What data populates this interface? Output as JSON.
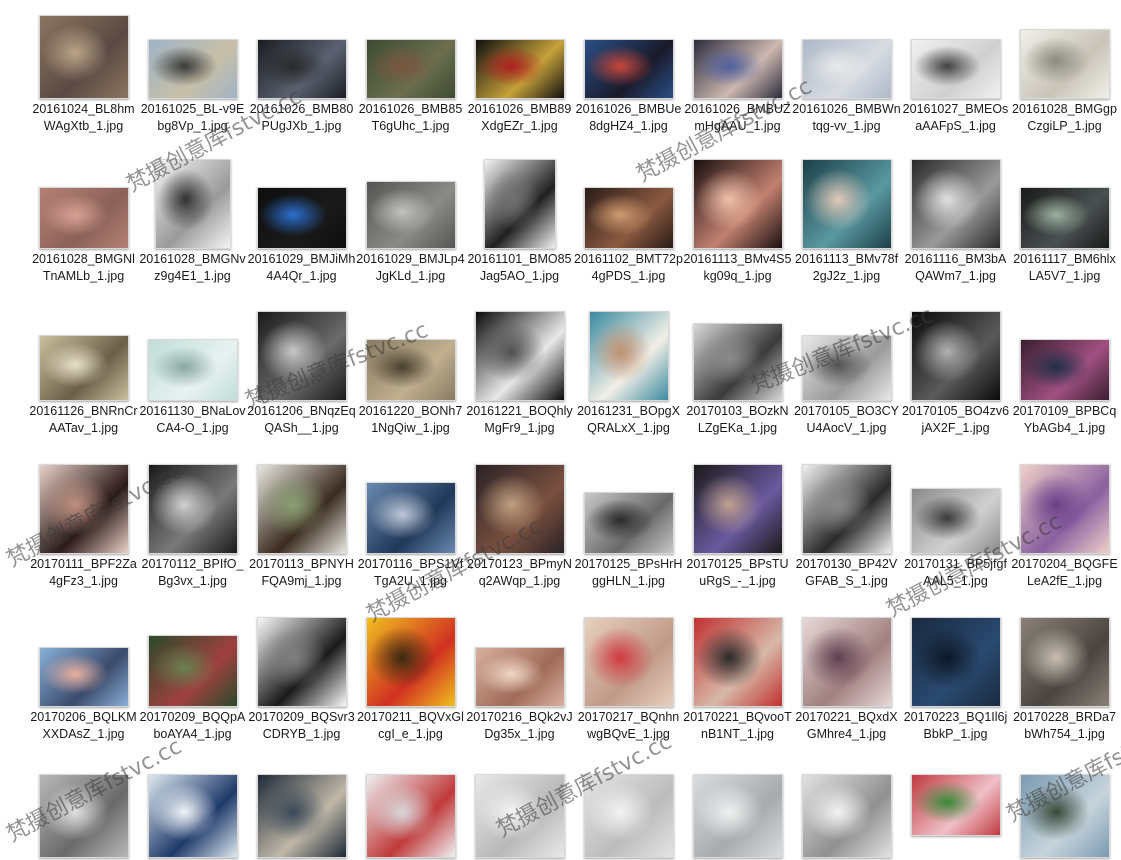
{
  "files": [
    {
      "name": "20161024_BL8hmWAgXtb_1.jpg",
      "colors": [
        "#8a7560",
        "#5a4a44",
        "#b9a488"
      ]
    },
    {
      "name": "20161025_BL-v9Ebg8Vp_1.jpg",
      "colors": [
        "#9fb3c6",
        "#c8c0a8",
        "#3a3a3a"
      ]
    },
    {
      "name": "20161026_BMB80PUgJXb_1.jpg",
      "colors": [
        "#1a1d22",
        "#5b6170",
        "#2a2a2a"
      ]
    },
    {
      "name": "20161026_BMB85T6gUhc_1.jpg",
      "colors": [
        "#3d4a32",
        "#6b6f4f",
        "#7a5640"
      ]
    },
    {
      "name": "20161026_BMB89XdgEZr_1.jpg",
      "colors": [
        "#111111",
        "#c6a23a",
        "#b02020"
      ]
    },
    {
      "name": "20161026_BMBUe8dgHZ4_1.jpg",
      "colors": [
        "#2a4f86",
        "#1a1a2a",
        "#c7463a"
      ]
    },
    {
      "name": "20161026_BMBUZmHgAAU_1.jpg",
      "colors": [
        "#2c2c3c",
        "#cdb8b0",
        "#5060a0"
      ]
    },
    {
      "name": "20161026_BMBWntqg-vv_1.jpg",
      "colors": [
        "#aeb8c8",
        "#d8dce2",
        "#e8e8e8"
      ]
    },
    {
      "name": "20161027_BMEOsaAAFpS_1.jpg",
      "colors": [
        "#f0f0f0",
        "#d0d0d0",
        "#404040"
      ]
    },
    {
      "name": "20161028_BMGgpCzgiLP_1.jpg",
      "colors": [
        "#f0efe8",
        "#c8c4b8",
        "#8a8a80"
      ]
    },
    {
      "name": "20161028_BMGNlTnAMLb_1.jpg",
      "colors": [
        "#b58076",
        "#8a6258",
        "#d9a095"
      ]
    },
    {
      "name": "20161028_BMGNvz9g4E1_1.jpg",
      "colors": [
        "#f4f4f4",
        "#9a9a9a",
        "#303030"
      ]
    },
    {
      "name": "20161029_BMJiMh4A4Qr_1.jpg",
      "colors": [
        "#0e0e0e",
        "#1a1a1a",
        "#2a6fd0"
      ]
    },
    {
      "name": "20161029_BMJLp4JgKLd_1.jpg",
      "colors": [
        "#555555",
        "#8a8a88",
        "#c0c0be"
      ]
    },
    {
      "name": "20161101_BMO85Jag5AO_1.jpg",
      "colors": [
        "#f2f2f2",
        "#202020",
        "#707070"
      ]
    },
    {
      "name": "20161102_BMT72p4gPDS_1.jpg",
      "colors": [
        "#2a1c18",
        "#8a5a40",
        "#d09a70"
      ]
    },
    {
      "name": "20161113_BMv4S5kg09q_1.jpg",
      "colors": [
        "#1a1010",
        "#c28070",
        "#f0c0a8"
      ]
    },
    {
      "name": "20161113_BMv78f2gJ2z_1.jpg",
      "colors": [
        "#1c4048",
        "#5a98a0",
        "#e0c8b8"
      ]
    },
    {
      "name": "20161116_BM3bAQAWm7_1.jpg",
      "colors": [
        "#2a2a2a",
        "#9a9a9a",
        "#e0e0e0"
      ]
    },
    {
      "name": "20161117_BM6hlxLA5V7_1.jpg",
      "colors": [
        "#1a1a1a",
        "#4a5050",
        "#9ab0a0"
      ]
    },
    {
      "name": "20161126_BNRnCrAATav_1.jpg",
      "colors": [
        "#c9c0a0",
        "#6a6048",
        "#e8e0c8"
      ]
    },
    {
      "name": "20161130_BNaLovCA4-O_1.jpg",
      "colors": [
        "#c0ddd8",
        "#e8f2f0",
        "#8aa8a0"
      ]
    },
    {
      "name": "20161206_BNqzEqQASh__1.jpg",
      "colors": [
        "#1a1a1a",
        "#6a6a6a",
        "#c8c8c8"
      ]
    },
    {
      "name": "20161220_BONh71NgQiw_1.jpg",
      "colors": [
        "#8a7a62",
        "#c0b090",
        "#4a4030"
      ]
    },
    {
      "name": "20161221_BOQhlyMgFr9_1.jpg",
      "colors": [
        "#0a0a0a",
        "#e8e8e8",
        "#505050"
      ]
    },
    {
      "name": "20161231_BOpgXQRALxX_1.jpg",
      "colors": [
        "#3a8aa0",
        "#f2efe6",
        "#c09070"
      ]
    },
    {
      "name": "20170103_BOzkNLZgEKa_1.jpg",
      "colors": [
        "#d8d8d8",
        "#3a3a3a",
        "#8a8a8a"
      ]
    },
    {
      "name": "20170105_BO3CYU4AocV_1.jpg",
      "colors": [
        "#e8e8e8",
        "#9a9a9a",
        "#505050"
      ]
    },
    {
      "name": "20170105_BO4zv6jAX2F_1.jpg",
      "colors": [
        "#0a0a0a",
        "#5a5a5a",
        "#b0b0b0"
      ]
    },
    {
      "name": "20170109_BPBCqYbAGb4_1.jpg",
      "colors": [
        "#3a1e30",
        "#a05080",
        "#20304a"
      ]
    },
    {
      "name": "20170111_BPF2Za4gFz3_1.jpg",
      "colors": [
        "#e8d0c8",
        "#2a1a18",
        "#c09080"
      ]
    },
    {
      "name": "20170112_BPIfO_Bg3vx_1.jpg",
      "colors": [
        "#1a1a1a",
        "#7a7a7a",
        "#d0d0d0"
      ]
    },
    {
      "name": "20170113_BPNYHFQA9mj_1.jpg",
      "colors": [
        "#e8e8e0",
        "#3a2a20",
        "#8aa070"
      ]
    },
    {
      "name": "20170116_BPS1VfTgA2U_1.jpg",
      "colors": [
        "#6a8ab0",
        "#203858",
        "#c0c8d8"
      ]
    },
    {
      "name": "20170123_BPmyNq2AWqp_1.jpg",
      "colors": [
        "#2a2226",
        "#7a5040",
        "#c0a080"
      ]
    },
    {
      "name": "20170125_BPsHrHggHLN_1.jpg",
      "colors": [
        "#c8c8c8",
        "#6a6a6a",
        "#2a2a2a"
      ]
    },
    {
      "name": "20170125_BPsTUuRgS_-_1.jpg",
      "colors": [
        "#1a1a1a",
        "#6a5aa0",
        "#c0a090"
      ]
    },
    {
      "name": "20170130_BP42VGFAB_S_1.jpg",
      "colors": [
        "#f0f0f0",
        "#2a2a2a",
        "#8a8a8a"
      ]
    },
    {
      "name": "20170131_BP5jfgfAAL5_1.jpg",
      "colors": [
        "#8a8a8a",
        "#d0d0d0",
        "#3a3a3a"
      ]
    },
    {
      "name": "20170204_BQGFELeA2fE_1.jpg",
      "colors": [
        "#f0d0c8",
        "#8a60a0",
        "#6a4088"
      ]
    },
    {
      "name": "20170206_BQLKMXXDAsZ_1.jpg",
      "colors": [
        "#8ab0d8",
        "#3a4a6a",
        "#e8b0a0"
      ]
    },
    {
      "name": "20170209_BQQpAboAYA4_1.jpg",
      "colors": [
        "#2a4a2a",
        "#a04040",
        "#6a8050"
      ]
    },
    {
      "name": "20170209_BQSvr3CDRYB_1.jpg",
      "colors": [
        "#f8f8f8",
        "#1a1a1a",
        "#808080"
      ]
    },
    {
      "name": "20170211_BQVxGlcgI_e_1.jpg",
      "colors": [
        "#f0c020",
        "#d03020",
        "#3a2a10"
      ]
    },
    {
      "name": "20170216_BQk2vJDg35x_1.jpg",
      "colors": [
        "#d8b0a0",
        "#a06a58",
        "#f0d8c8"
      ]
    },
    {
      "name": "20170217_BQnhnwgBQvE_1.jpg",
      "colors": [
        "#e8d0c0",
        "#c09a88",
        "#d03a40"
      ]
    },
    {
      "name": "20170221_BQvooTnB1NT_1.jpg",
      "colors": [
        "#c03030",
        "#d8b8a8",
        "#2a2a2a"
      ]
    },
    {
      "name": "20170221_BQxdXGMhre4_1.jpg",
      "colors": [
        "#e8d8d8",
        "#a08080",
        "#604050"
      ]
    },
    {
      "name": "20170223_BQ1Il6jBbkP_1.jpg",
      "colors": [
        "#1a2a40",
        "#2a4a70",
        "#0e1828"
      ]
    },
    {
      "name": "20170228_BRDa7bWh754_1.jpg",
      "colors": [
        "#8a8278",
        "#4a4440",
        "#c8c0b4"
      ]
    },
    {
      "name": "",
      "colors": [
        "#b8b8b8",
        "#6a6a6a",
        "#e0e0e0"
      ]
    },
    {
      "name": "",
      "colors": [
        "#dde8f0",
        "#1f3a6a",
        "#f0f4f8"
      ]
    },
    {
      "name": "",
      "colors": [
        "#1e2a38",
        "#c0b8a8",
        "#3a4858"
      ]
    },
    {
      "name": "",
      "colors": [
        "#eef0f2",
        "#c03a3a",
        "#d8d8dc"
      ]
    },
    {
      "name": "",
      "colors": [
        "#e8e8e8",
        "#b8b8b8",
        "#f4f4f4"
      ]
    },
    {
      "name": "",
      "colors": [
        "#e4e4e4",
        "#bcbcbc",
        "#f2f2f2"
      ]
    },
    {
      "name": "",
      "colors": [
        "#dadcde",
        "#a8aaac",
        "#f0f0f0"
      ]
    },
    {
      "name": "",
      "colors": [
        "#e2e2e2",
        "#909090",
        "#f4f4f4"
      ]
    },
    {
      "name": "",
      "colors": [
        "#c03a40",
        "#f0c0c8",
        "#3a8a3a"
      ]
    },
    {
      "name": "",
      "colors": [
        "#7a9ab0",
        "#c8d4dc",
        "#3a4a3a"
      ]
    }
  ],
  "watermark": "梵摄创意库fstvc.cc"
}
